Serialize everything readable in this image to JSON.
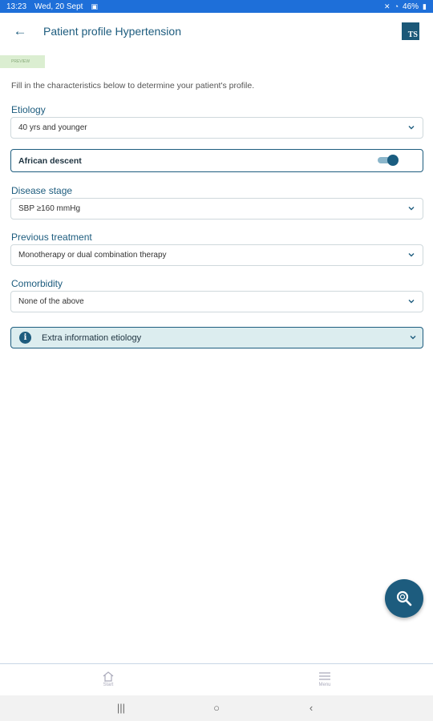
{
  "status_bar": {
    "time": "13:23",
    "date": "Wed, 20 Sept",
    "battery": "46%"
  },
  "header": {
    "title": "Patient profile Hypertension",
    "logo_text": "TS"
  },
  "badge": "PREVIEW",
  "intro": "Fill in the characteristics below to determine your patient's profile.",
  "fields": {
    "etiology": {
      "label": "Etiology",
      "value": "40 yrs and younger"
    },
    "african": {
      "label": "African descent",
      "on": true
    },
    "disease_stage": {
      "label": "Disease stage",
      "value": "SBP ≥160 mmHg"
    },
    "previous_treatment": {
      "label": "Previous treatment",
      "value": "Monotherapy or dual combination therapy"
    },
    "comorbidity": {
      "label": "Comorbidity",
      "value": "None of the above"
    }
  },
  "info_panel": {
    "label": "Extra information etiology"
  },
  "bottom_nav": {
    "start": "Start",
    "menu": "Menu"
  },
  "colors": {
    "primary": "#1d5c7e",
    "statusbar": "#1e6fd9",
    "info_bg": "#dcedef"
  },
  "icons": [
    "back-arrow-icon",
    "chevron-down-icon",
    "info-icon",
    "search-icon",
    "home-icon",
    "menu-icon"
  ]
}
